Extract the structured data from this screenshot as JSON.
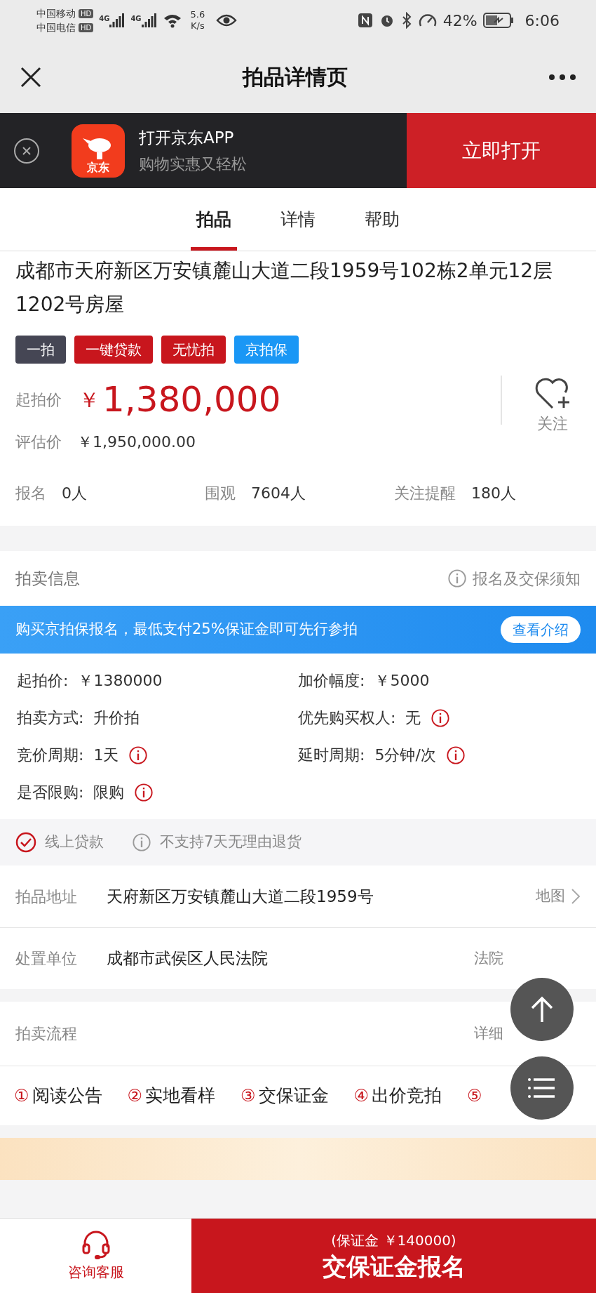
{
  "status_bar": {
    "carriers": [
      {
        "name": "中国移动",
        "badge": "HD"
      },
      {
        "name": "中国电信",
        "badge": "HD"
      }
    ],
    "networks": [
      "4G",
      "4G"
    ],
    "speed": "5.6",
    "speed_unit": "K/s",
    "battery": "42%",
    "time": "6:06"
  },
  "header": {
    "title": "拍品详情页"
  },
  "app_banner": {
    "title": "打开京东APP",
    "subtitle": "购物实惠又轻松",
    "logo_text": "京东",
    "button": "立即打开"
  },
  "tabs": [
    {
      "label": "拍品",
      "selected": true
    },
    {
      "label": "详情",
      "selected": false
    },
    {
      "label": "帮助",
      "selected": false
    }
  ],
  "item": {
    "title": "成都市天府新区万安镇麓山大道二段1959号102栋2单元12层1202号房屋",
    "tags": [
      {
        "label": "一拍",
        "color": "#454654"
      },
      {
        "label": "一键贷款",
        "color": "#c8161d"
      },
      {
        "label": "无忧拍",
        "color": "#c8161d"
      },
      {
        "label": "京拍保",
        "color": "#1a97f5"
      }
    ],
    "start_price_label": "起拍价",
    "currency": "￥",
    "start_price": "1,380,000",
    "follow": "关注",
    "estimate_label": "评估价",
    "estimate": "￥1,950,000.00",
    "stats": [
      {
        "label": "报名",
        "value": "0人"
      },
      {
        "label": "围观",
        "value": "7604人"
      },
      {
        "label": "关注提醒",
        "value": "180人"
      }
    ]
  },
  "auction_info": {
    "title": "拍卖信息",
    "notice_link": "报名及交保须知",
    "promo": "购买京拍保报名，最低支付25%保证金即可先行参拍",
    "promo_button": "查看介绍",
    "fields": [
      {
        "label": "起拍价:",
        "value": "￥1380000",
        "info": false
      },
      {
        "label": "加价幅度:",
        "value": "￥5000",
        "info": false
      },
      {
        "label": "拍卖方式:",
        "value": "升价拍",
        "info": false
      },
      {
        "label": "优先购买权人:",
        "value": "无",
        "info": true
      },
      {
        "label": "竞价周期:",
        "value": "1天",
        "info": true
      },
      {
        "label": "延时周期:",
        "value": "5分钟/次",
        "info": true
      },
      {
        "label": "是否限购:",
        "value": "限购",
        "info": true
      }
    ],
    "features": [
      {
        "label": "线上贷款",
        "supported": true
      },
      {
        "label": "不支持7天无理由退货",
        "supported": false
      }
    ]
  },
  "rows": [
    {
      "label": "拍品地址",
      "value": "天府新区万安镇麓山大道二段1959号",
      "link": "地图"
    },
    {
      "label": "处置单位",
      "value": "成都市武侯区人民法院",
      "link": "法院"
    }
  ],
  "process": {
    "title": "拍卖流程",
    "link": "详细",
    "steps": [
      {
        "num": "①",
        "label": "阅读公告"
      },
      {
        "num": "②",
        "label": "实地看样"
      },
      {
        "num": "③",
        "label": "交保证金"
      },
      {
        "num": "④",
        "label": "出价竞拍"
      },
      {
        "num": "⑤"
      }
    ]
  },
  "bottom_bar": {
    "service": "咨询客服",
    "deposit": "(保证金 ￥140000)",
    "action": "交保证金报名"
  }
}
